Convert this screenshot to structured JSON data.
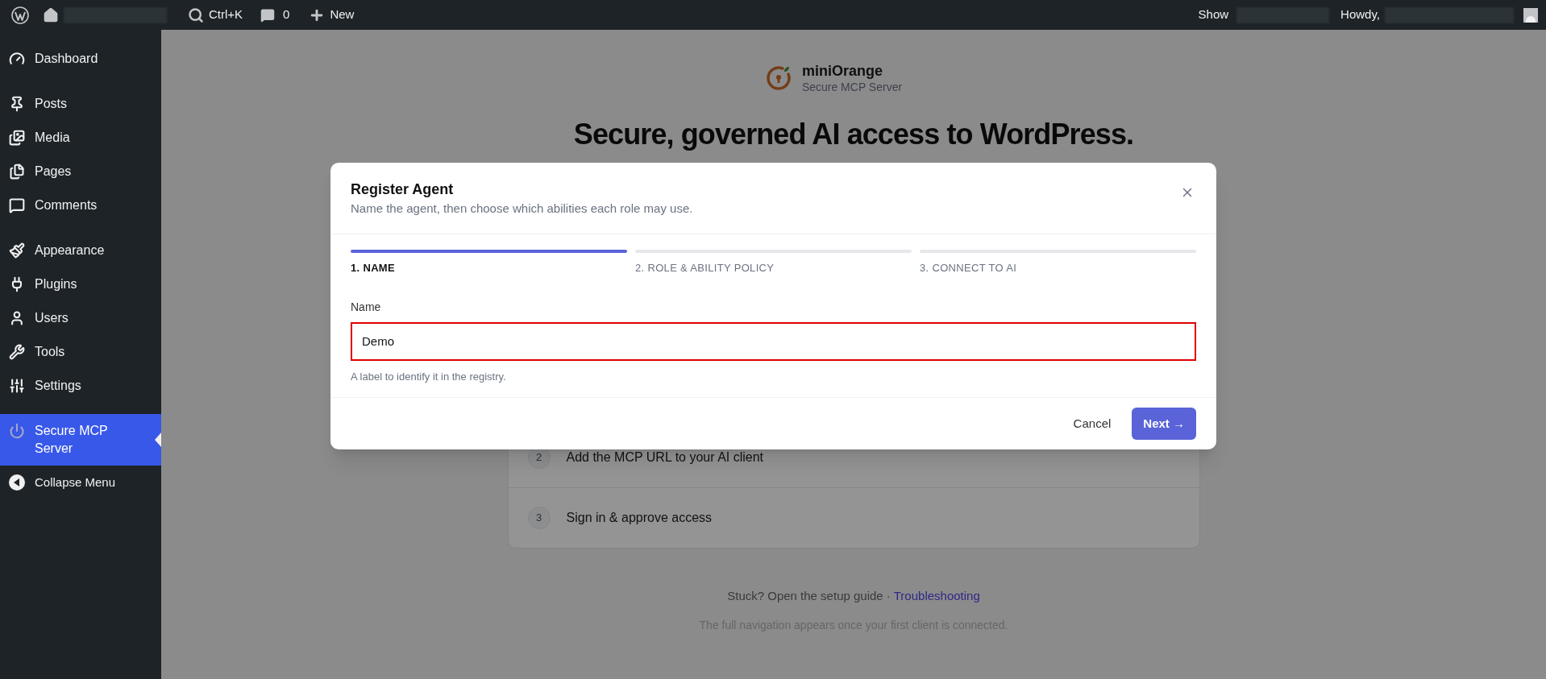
{
  "top_bar": {
    "search_shortcut": "Ctrl+K",
    "comments_count": "0",
    "new_label": "New",
    "show_label": "Show",
    "greeting": "Howdy,"
  },
  "sidebar": {
    "groups": [
      [
        {
          "label": "Dashboard",
          "selected": false
        }
      ],
      [
        {
          "label": "Posts",
          "selected": false
        },
        {
          "label": "Media",
          "selected": false
        },
        {
          "label": "Pages",
          "selected": false
        },
        {
          "label": "Comments",
          "selected": false
        }
      ],
      [
        {
          "label": "Appearance",
          "selected": false
        },
        {
          "label": "Plugins",
          "selected": false
        },
        {
          "label": "Users",
          "selected": false
        },
        {
          "label": "Tools",
          "selected": false
        },
        {
          "label": "Settings",
          "selected": false
        }
      ],
      [
        {
          "label": "Secure MCP Server",
          "selected": true
        }
      ]
    ],
    "collapse_label": "Collapse Menu"
  },
  "page": {
    "brand": "miniOrange",
    "product": "Secure MCP Server",
    "headline": "Secure, governed AI access to WordPress.",
    "steps": [
      {
        "number": "2",
        "text": "Add the MCP URL to your AI client"
      },
      {
        "number": "3",
        "text": "Sign in & approve access"
      }
    ],
    "footer_text": "Stuck? Open the setup guide ·",
    "footer_link": "Troubleshooting",
    "note": "The full navigation appears once your first client is connected."
  },
  "dialog": {
    "title": "Register Agent",
    "subtitle": "Name the agent, then choose which abilities each role may use.",
    "steps": [
      {
        "label": "1. NAME",
        "selected": true
      },
      {
        "label": "2. ROLE & ABILITY POLICY",
        "selected": false
      },
      {
        "label": "3. CONNECT TO AI",
        "selected": false
      }
    ],
    "field": {
      "label": "Name",
      "value": "Demo",
      "error": true,
      "hint": "A label to identify it in the registry."
    },
    "cancel": "Cancel",
    "next": "Next →"
  }
}
